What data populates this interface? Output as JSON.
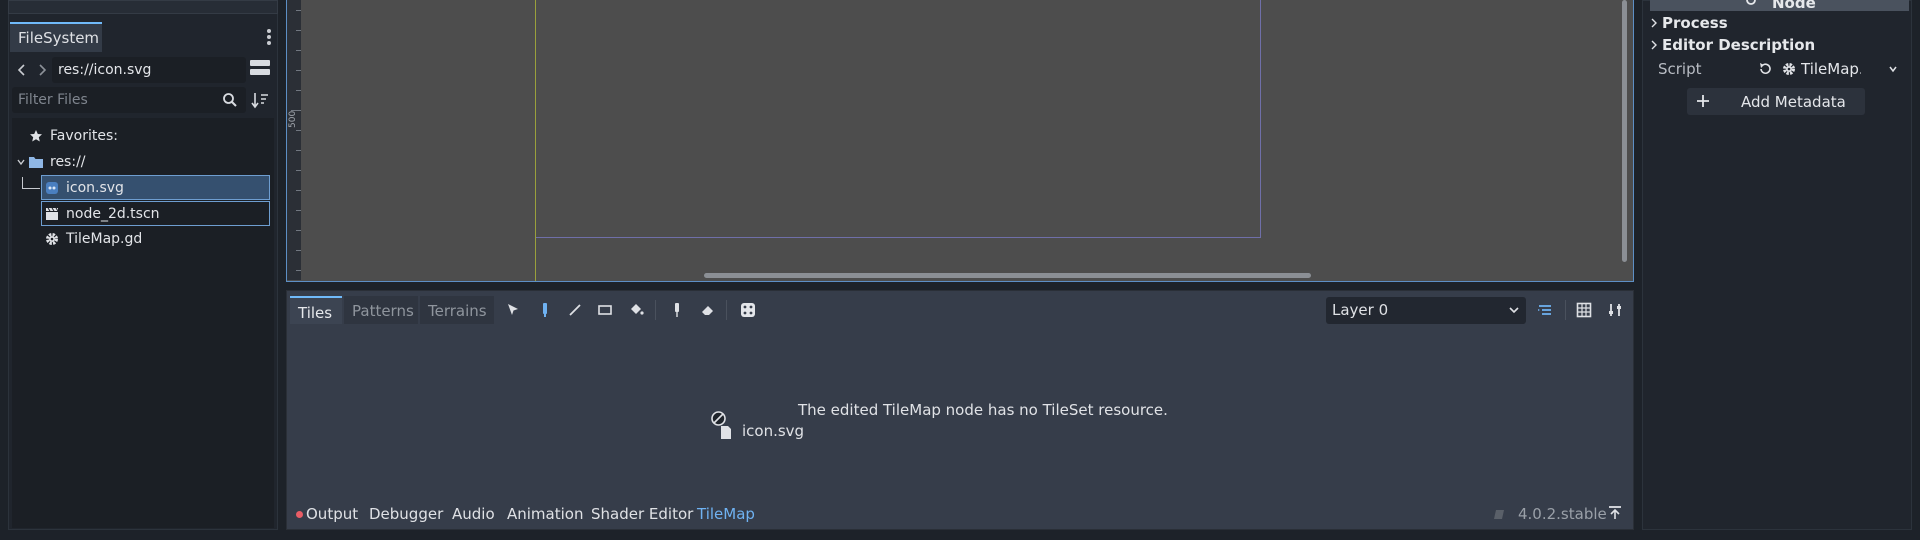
{
  "filesystem": {
    "tab_label": "FileSystem",
    "path": "res://icon.svg",
    "filter_placeholder": "Filter Files",
    "tree": {
      "favorites_label": "Favorites:",
      "root_label": "res://",
      "files": [
        {
          "label": "icon.svg",
          "icon": "svg-image-icon"
        },
        {
          "label": "node_2d.tscn",
          "icon": "scene-clapper-icon"
        },
        {
          "label": "TileMap.gd",
          "icon": "gear-icon"
        }
      ]
    }
  },
  "viewport": {
    "ruler_label": "500"
  },
  "tilemap_panel": {
    "tabs": [
      "Tiles",
      "Patterns",
      "Terrains"
    ],
    "layer_select": "Layer 0",
    "message": "The edited TileMap node has no TileSet resource.",
    "drag_preview_label": "icon.svg"
  },
  "bottom_bar": {
    "tabs": [
      "Output",
      "Debugger",
      "Audio",
      "Animation",
      "Shader Editor",
      "TileMap"
    ],
    "active_tab": "TileMap",
    "version": "4.0.2.stable"
  },
  "inspector": {
    "header": "Node",
    "sections": [
      "Process",
      "Editor Description"
    ],
    "script_label": "Script",
    "script_value": "TileMap.gd",
    "add_metadata_label": "Add Metadata"
  },
  "colors": {
    "accent": "#70bafa",
    "selection": "#35506f",
    "error_dot": "#e95d66",
    "background": "#1d2229"
  }
}
